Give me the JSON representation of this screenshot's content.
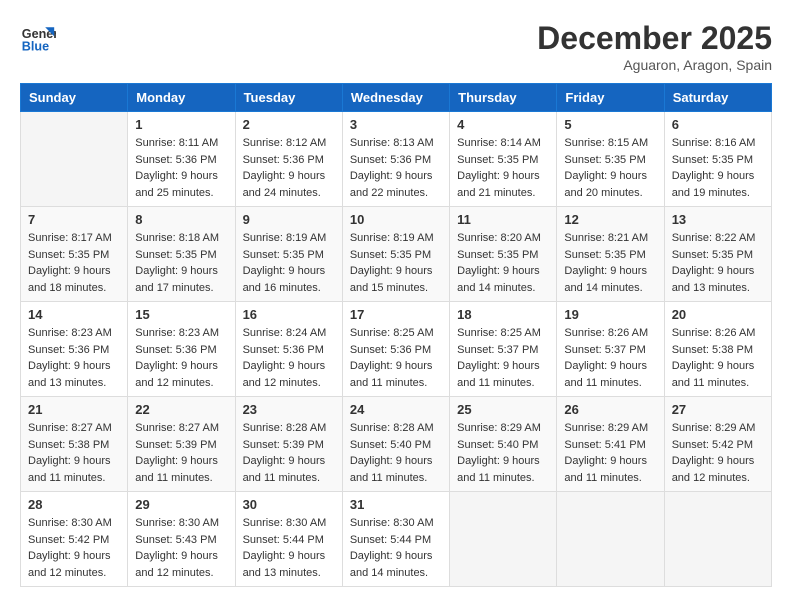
{
  "header": {
    "logo_line1": "General",
    "logo_line2": "Blue",
    "month_year": "December 2025",
    "location": "Aguaron, Aragon, Spain"
  },
  "weekdays": [
    "Sunday",
    "Monday",
    "Tuesday",
    "Wednesday",
    "Thursday",
    "Friday",
    "Saturday"
  ],
  "weeks": [
    [
      {
        "day": "",
        "sunrise": "",
        "sunset": "",
        "daylight": ""
      },
      {
        "day": "1",
        "sunrise": "Sunrise: 8:11 AM",
        "sunset": "Sunset: 5:36 PM",
        "daylight": "Daylight: 9 hours and 25 minutes."
      },
      {
        "day": "2",
        "sunrise": "Sunrise: 8:12 AM",
        "sunset": "Sunset: 5:36 PM",
        "daylight": "Daylight: 9 hours and 24 minutes."
      },
      {
        "day": "3",
        "sunrise": "Sunrise: 8:13 AM",
        "sunset": "Sunset: 5:36 PM",
        "daylight": "Daylight: 9 hours and 22 minutes."
      },
      {
        "day": "4",
        "sunrise": "Sunrise: 8:14 AM",
        "sunset": "Sunset: 5:35 PM",
        "daylight": "Daylight: 9 hours and 21 minutes."
      },
      {
        "day": "5",
        "sunrise": "Sunrise: 8:15 AM",
        "sunset": "Sunset: 5:35 PM",
        "daylight": "Daylight: 9 hours and 20 minutes."
      },
      {
        "day": "6",
        "sunrise": "Sunrise: 8:16 AM",
        "sunset": "Sunset: 5:35 PM",
        "daylight": "Daylight: 9 hours and 19 minutes."
      }
    ],
    [
      {
        "day": "7",
        "sunrise": "Sunrise: 8:17 AM",
        "sunset": "Sunset: 5:35 PM",
        "daylight": "Daylight: 9 hours and 18 minutes."
      },
      {
        "day": "8",
        "sunrise": "Sunrise: 8:18 AM",
        "sunset": "Sunset: 5:35 PM",
        "daylight": "Daylight: 9 hours and 17 minutes."
      },
      {
        "day": "9",
        "sunrise": "Sunrise: 8:19 AM",
        "sunset": "Sunset: 5:35 PM",
        "daylight": "Daylight: 9 hours and 16 minutes."
      },
      {
        "day": "10",
        "sunrise": "Sunrise: 8:19 AM",
        "sunset": "Sunset: 5:35 PM",
        "daylight": "Daylight: 9 hours and 15 minutes."
      },
      {
        "day": "11",
        "sunrise": "Sunrise: 8:20 AM",
        "sunset": "Sunset: 5:35 PM",
        "daylight": "Daylight: 9 hours and 14 minutes."
      },
      {
        "day": "12",
        "sunrise": "Sunrise: 8:21 AM",
        "sunset": "Sunset: 5:35 PM",
        "daylight": "Daylight: 9 hours and 14 minutes."
      },
      {
        "day": "13",
        "sunrise": "Sunrise: 8:22 AM",
        "sunset": "Sunset: 5:35 PM",
        "daylight": "Daylight: 9 hours and 13 minutes."
      }
    ],
    [
      {
        "day": "14",
        "sunrise": "Sunrise: 8:23 AM",
        "sunset": "Sunset: 5:36 PM",
        "daylight": "Daylight: 9 hours and 13 minutes."
      },
      {
        "day": "15",
        "sunrise": "Sunrise: 8:23 AM",
        "sunset": "Sunset: 5:36 PM",
        "daylight": "Daylight: 9 hours and 12 minutes."
      },
      {
        "day": "16",
        "sunrise": "Sunrise: 8:24 AM",
        "sunset": "Sunset: 5:36 PM",
        "daylight": "Daylight: 9 hours and 12 minutes."
      },
      {
        "day": "17",
        "sunrise": "Sunrise: 8:25 AM",
        "sunset": "Sunset: 5:36 PM",
        "daylight": "Daylight: 9 hours and 11 minutes."
      },
      {
        "day": "18",
        "sunrise": "Sunrise: 8:25 AM",
        "sunset": "Sunset: 5:37 PM",
        "daylight": "Daylight: 9 hours and 11 minutes."
      },
      {
        "day": "19",
        "sunrise": "Sunrise: 8:26 AM",
        "sunset": "Sunset: 5:37 PM",
        "daylight": "Daylight: 9 hours and 11 minutes."
      },
      {
        "day": "20",
        "sunrise": "Sunrise: 8:26 AM",
        "sunset": "Sunset: 5:38 PM",
        "daylight": "Daylight: 9 hours and 11 minutes."
      }
    ],
    [
      {
        "day": "21",
        "sunrise": "Sunrise: 8:27 AM",
        "sunset": "Sunset: 5:38 PM",
        "daylight": "Daylight: 9 hours and 11 minutes."
      },
      {
        "day": "22",
        "sunrise": "Sunrise: 8:27 AM",
        "sunset": "Sunset: 5:39 PM",
        "daylight": "Daylight: 9 hours and 11 minutes."
      },
      {
        "day": "23",
        "sunrise": "Sunrise: 8:28 AM",
        "sunset": "Sunset: 5:39 PM",
        "daylight": "Daylight: 9 hours and 11 minutes."
      },
      {
        "day": "24",
        "sunrise": "Sunrise: 8:28 AM",
        "sunset": "Sunset: 5:40 PM",
        "daylight": "Daylight: 9 hours and 11 minutes."
      },
      {
        "day": "25",
        "sunrise": "Sunrise: 8:29 AM",
        "sunset": "Sunset: 5:40 PM",
        "daylight": "Daylight: 9 hours and 11 minutes."
      },
      {
        "day": "26",
        "sunrise": "Sunrise: 8:29 AM",
        "sunset": "Sunset: 5:41 PM",
        "daylight": "Daylight: 9 hours and 11 minutes."
      },
      {
        "day": "27",
        "sunrise": "Sunrise: 8:29 AM",
        "sunset": "Sunset: 5:42 PM",
        "daylight": "Daylight: 9 hours and 12 minutes."
      }
    ],
    [
      {
        "day": "28",
        "sunrise": "Sunrise: 8:30 AM",
        "sunset": "Sunset: 5:42 PM",
        "daylight": "Daylight: 9 hours and 12 minutes."
      },
      {
        "day": "29",
        "sunrise": "Sunrise: 8:30 AM",
        "sunset": "Sunset: 5:43 PM",
        "daylight": "Daylight: 9 hours and 12 minutes."
      },
      {
        "day": "30",
        "sunrise": "Sunrise: 8:30 AM",
        "sunset": "Sunset: 5:44 PM",
        "daylight": "Daylight: 9 hours and 13 minutes."
      },
      {
        "day": "31",
        "sunrise": "Sunrise: 8:30 AM",
        "sunset": "Sunset: 5:44 PM",
        "daylight": "Daylight: 9 hours and 14 minutes."
      },
      {
        "day": "",
        "sunrise": "",
        "sunset": "",
        "daylight": ""
      },
      {
        "day": "",
        "sunrise": "",
        "sunset": "",
        "daylight": ""
      },
      {
        "day": "",
        "sunrise": "",
        "sunset": "",
        "daylight": ""
      }
    ]
  ]
}
